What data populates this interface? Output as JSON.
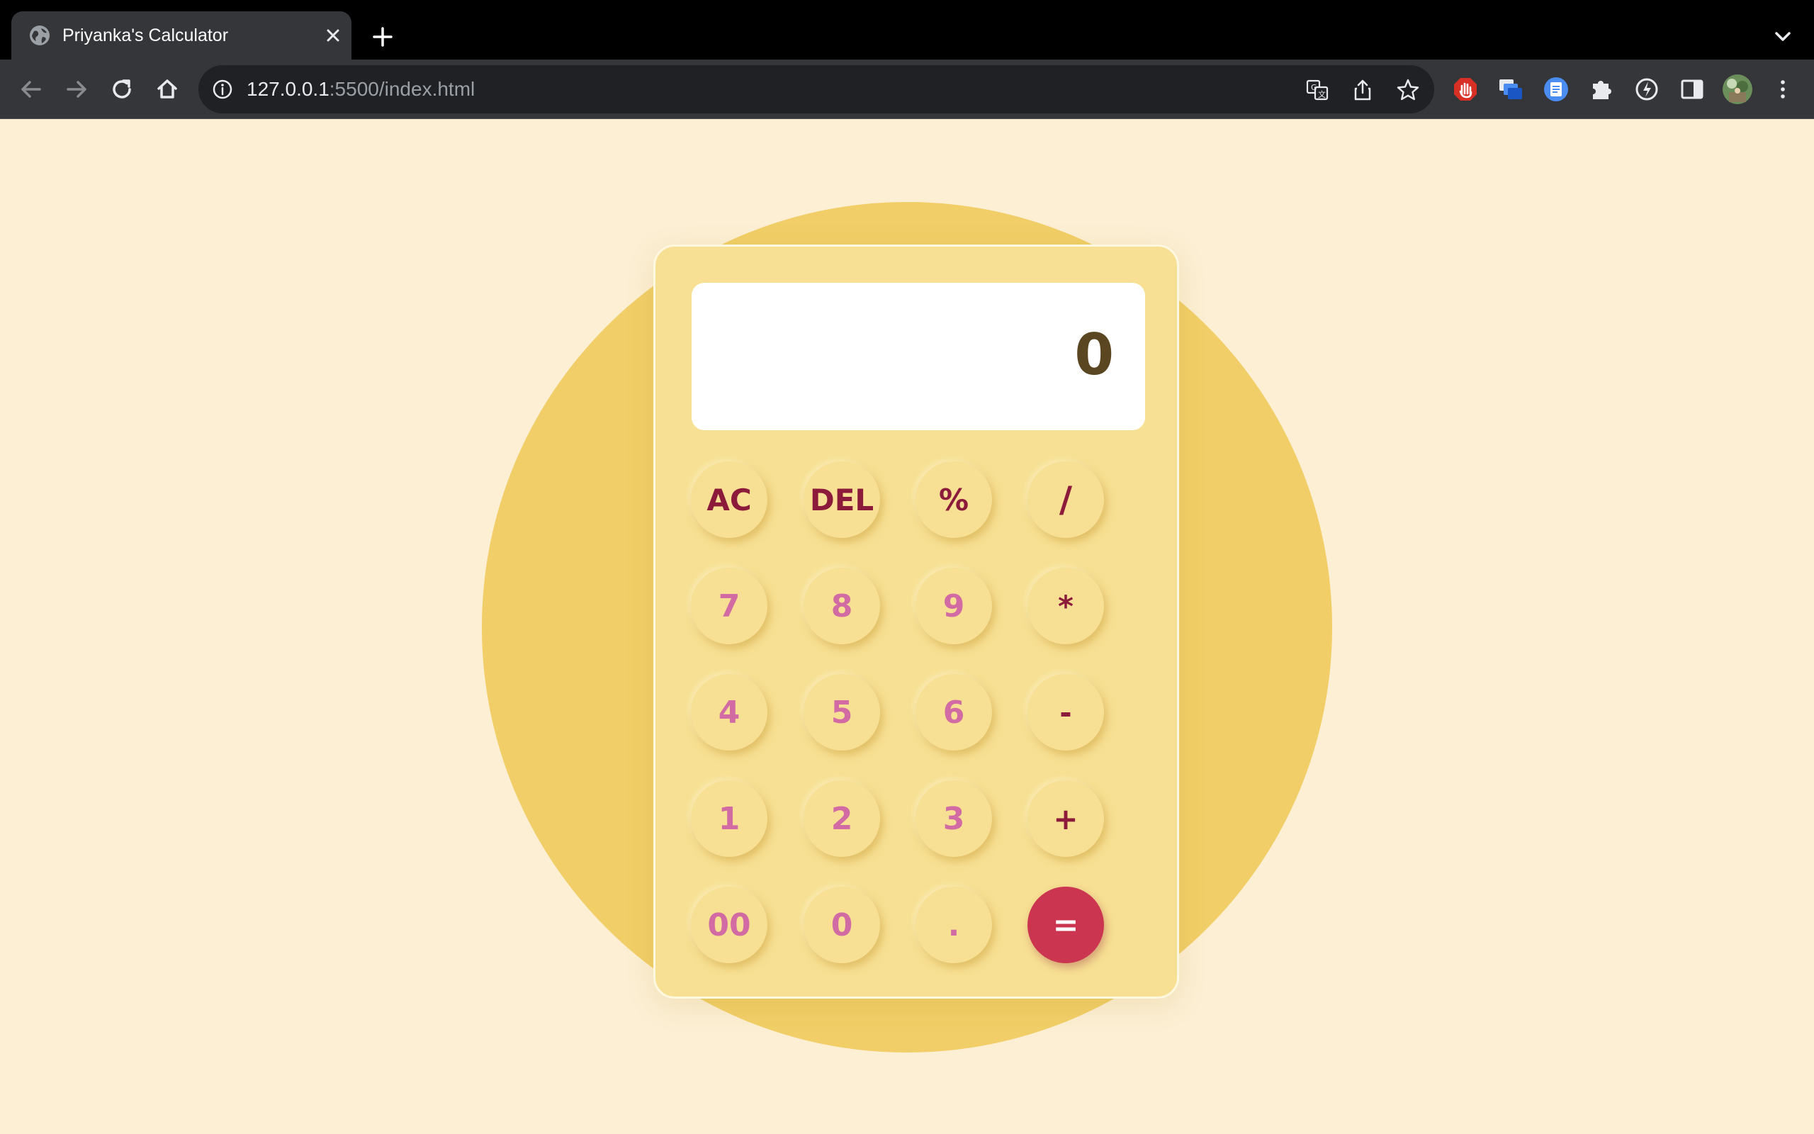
{
  "browser": {
    "tab_title": "Priyanka's Calculator",
    "url_host": "127.0.0.1",
    "url_path": ":5500/index.html",
    "icons": {
      "favicon": "globe-icon",
      "close": "close-icon",
      "new_tab": "plus-icon",
      "tab_search": "chevron-down-icon",
      "back": "back-arrow-icon",
      "forward": "forward-arrow-icon",
      "reload": "reload-icon",
      "home": "home-icon",
      "site_info": "info-icon",
      "translate": "translate-icon",
      "share": "share-icon",
      "bookmark": "star-icon",
      "extensions": [
        "adblock-icon",
        "tab-manager-icon",
        "docs-icon",
        "puzzle-icon",
        "speed-icon",
        "side-panel-icon",
        "avatar-icon",
        "more-vert-icon"
      ]
    }
  },
  "colors": {
    "page_background": "#fcefd3",
    "circle": "#f1ce67",
    "calculator_body": "#f7e093",
    "operator_text": "#8b1a3b",
    "number_text": "#d26aa4",
    "equals_background": "#cc3550",
    "display_text": "#5a4722"
  },
  "calculator": {
    "display": "0",
    "keys": {
      "ac": "AC",
      "del": "DEL",
      "percent": "%",
      "divide": "/",
      "seven": "7",
      "eight": "8",
      "nine": "9",
      "multiply": "*",
      "four": "4",
      "five": "5",
      "six": "6",
      "minus": "-",
      "one": "1",
      "two": "2",
      "three": "3",
      "plus": "+",
      "double_zero": "00",
      "zero": "0",
      "dot": ".",
      "equals": "="
    }
  }
}
